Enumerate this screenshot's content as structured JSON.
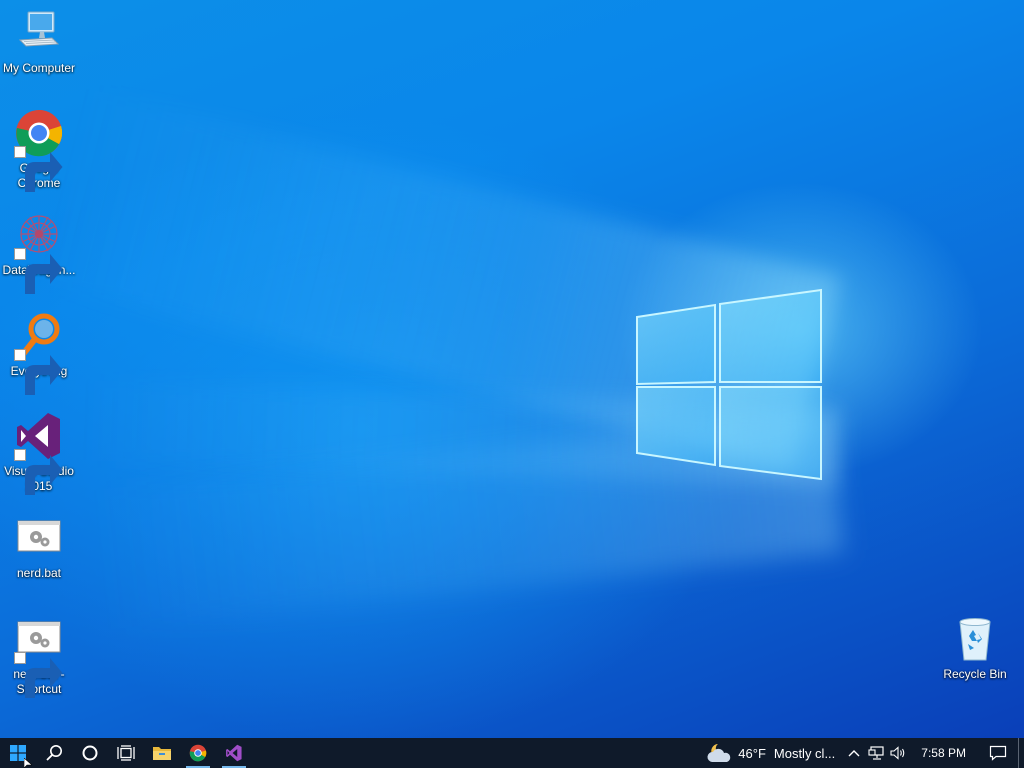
{
  "desktop": {
    "icons": [
      {
        "name": "my-computer",
        "label": "My Computer",
        "icon": "computer-icon",
        "shortcut": false
      },
      {
        "name": "google-chrome",
        "label": "Google Chrome",
        "icon": "chrome-icon",
        "shortcut": true
      },
      {
        "name": "datawagon",
        "label": "DataWagon...",
        "icon": "datawagon-icon",
        "shortcut": true
      },
      {
        "name": "everything",
        "label": "Everything",
        "icon": "everything-search-icon",
        "shortcut": true
      },
      {
        "name": "visual-studio",
        "label": "Visual Studio 2015",
        "icon": "visual-studio-icon",
        "shortcut": true
      },
      {
        "name": "nerd-bat",
        "label": "nerd.bat",
        "icon": "batch-file-icon",
        "shortcut": false
      },
      {
        "name": "nerd-bat-shortcut",
        "label": "nerd.bat - Shortcut",
        "icon": "batch-file-icon",
        "shortcut": true
      },
      {
        "name": "recycle-bin",
        "label": "Recycle Bin",
        "icon": "recycle-bin-icon",
        "shortcut": false
      }
    ]
  },
  "taskbar": {
    "buttons": [
      {
        "name": "start-button",
        "icon": "windows-logo-icon"
      },
      {
        "name": "search-button",
        "icon": "search-icon"
      },
      {
        "name": "cortana-button",
        "icon": "cortana-circle-icon"
      },
      {
        "name": "task-view-button",
        "icon": "task-view-icon"
      },
      {
        "name": "file-explorer-button",
        "icon": "folder-icon"
      },
      {
        "name": "chrome-taskbar-button",
        "icon": "chrome-icon"
      },
      {
        "name": "visual-studio-taskbar-button",
        "icon": "visual-studio-icon"
      }
    ],
    "weather": {
      "temp": "46°F",
      "condition": "Mostly cl...",
      "icon": "partly-cloudy-moon-icon"
    },
    "tray_icons": [
      "chevron-up-icon",
      "network-icon",
      "volume-icon"
    ],
    "clock": "7:58 PM",
    "action_center_icon": "notification-icon"
  },
  "colors": {
    "wallpaper_primary": "#0a86ea",
    "wallpaper_dark": "#0a3fb8",
    "taskbar": "#0f1a2a",
    "accent": "#76b9ed"
  }
}
